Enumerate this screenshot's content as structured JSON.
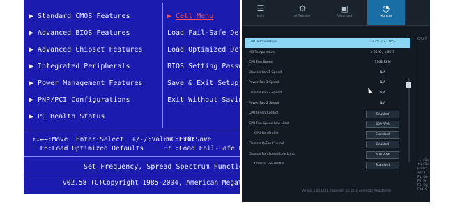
{
  "left": {
    "menu_left": [
      {
        "label": "Standard CMOS Features"
      },
      {
        "label": "Advanced BIOS Features"
      },
      {
        "label": "Advanced Chipset Features"
      },
      {
        "label": "Integrated Peripherals"
      },
      {
        "label": "Power Management Features"
      },
      {
        "label": "PNP/PCI Configurations"
      },
      {
        "label": "PC Health Status"
      }
    ],
    "menu_right": [
      {
        "label": "Cell Menu",
        "selected": true
      },
      {
        "label": "Load Fail-Safe Def"
      },
      {
        "label": "Load Optimized Def"
      },
      {
        "label": "BIOS Setting Passw"
      },
      {
        "label": "Save & Exit Setup"
      },
      {
        "label": "Exit Without Savin"
      }
    ],
    "arrow_symbol": "▶",
    "keys_line1": "↑↓←→:Move  Enter:Select  +/-/:Value  F10:Save",
    "keys_line2": "  F6:Load Optimized Defaults",
    "keys_right_line1": "ESC:Exit  F",
    "keys_right_line2": "F7 :Load Fail-Safe De",
    "help": "Set Frequency, Spread Spectrum Function ...",
    "copyright": "v02.58 (C)Copyright 1985-2004, American Megatrends"
  },
  "right": {
    "tabs": [
      {
        "label": "Main",
        "icon": "list-icon",
        "glyph": "☰"
      },
      {
        "label": "Ai Tweaker",
        "icon": "tweaker-icon",
        "glyph": "⚙"
      },
      {
        "label": "Advanced",
        "icon": "advanced-icon",
        "glyph": "▣"
      },
      {
        "label": "Monitor",
        "icon": "monitor-icon",
        "glyph": "◔",
        "active": true
      }
    ],
    "rows": [
      {
        "label": "CPU Temperature",
        "value": "+47°C / +116°F",
        "selected": true
      },
      {
        "label": "MB Temperature",
        "value": "+35°C / +95°F"
      },
      {
        "label": "CPU Fan Speed",
        "value": "1762 RPM"
      },
      {
        "label": "Chassis Fan 1 Speed",
        "value": "N/A"
      },
      {
        "label": "Power Fan 1 Speed",
        "value": "N/A"
      },
      {
        "label": "Chassis Fan 2 Speed",
        "value": "N/A"
      },
      {
        "label": "Power Fan 2 Speed",
        "value": "N/A"
      },
      {
        "label": "CPU Q-Fan Control",
        "value": "Enabled",
        "box": true
      },
      {
        "label": "CPU Fan Speed Low Limit",
        "value": "600 RPM",
        "box": true
      },
      {
        "label": "CPU Fan Profile",
        "value": "Standard",
        "box": true,
        "indent": true
      },
      {
        "label": "Chassis Q-Fan Control",
        "value": "Enabled",
        "box": true
      },
      {
        "label": "Chassis Fan Speed Low Limit",
        "value": "600 RPM",
        "box": true
      },
      {
        "label": "Chassis Fan Profile",
        "value": "Standard",
        "box": true,
        "indent": true
      }
    ],
    "side_title": "CPU T",
    "side_keys": "→←: Se\n↑↓: Se\nEnter:\n+/-: C\nF1: Ge\nF2: Pr\nF5: Op\nF10: S",
    "version": "Version 2.00.1201. Copyright (C) 2010 American Megatrends"
  }
}
